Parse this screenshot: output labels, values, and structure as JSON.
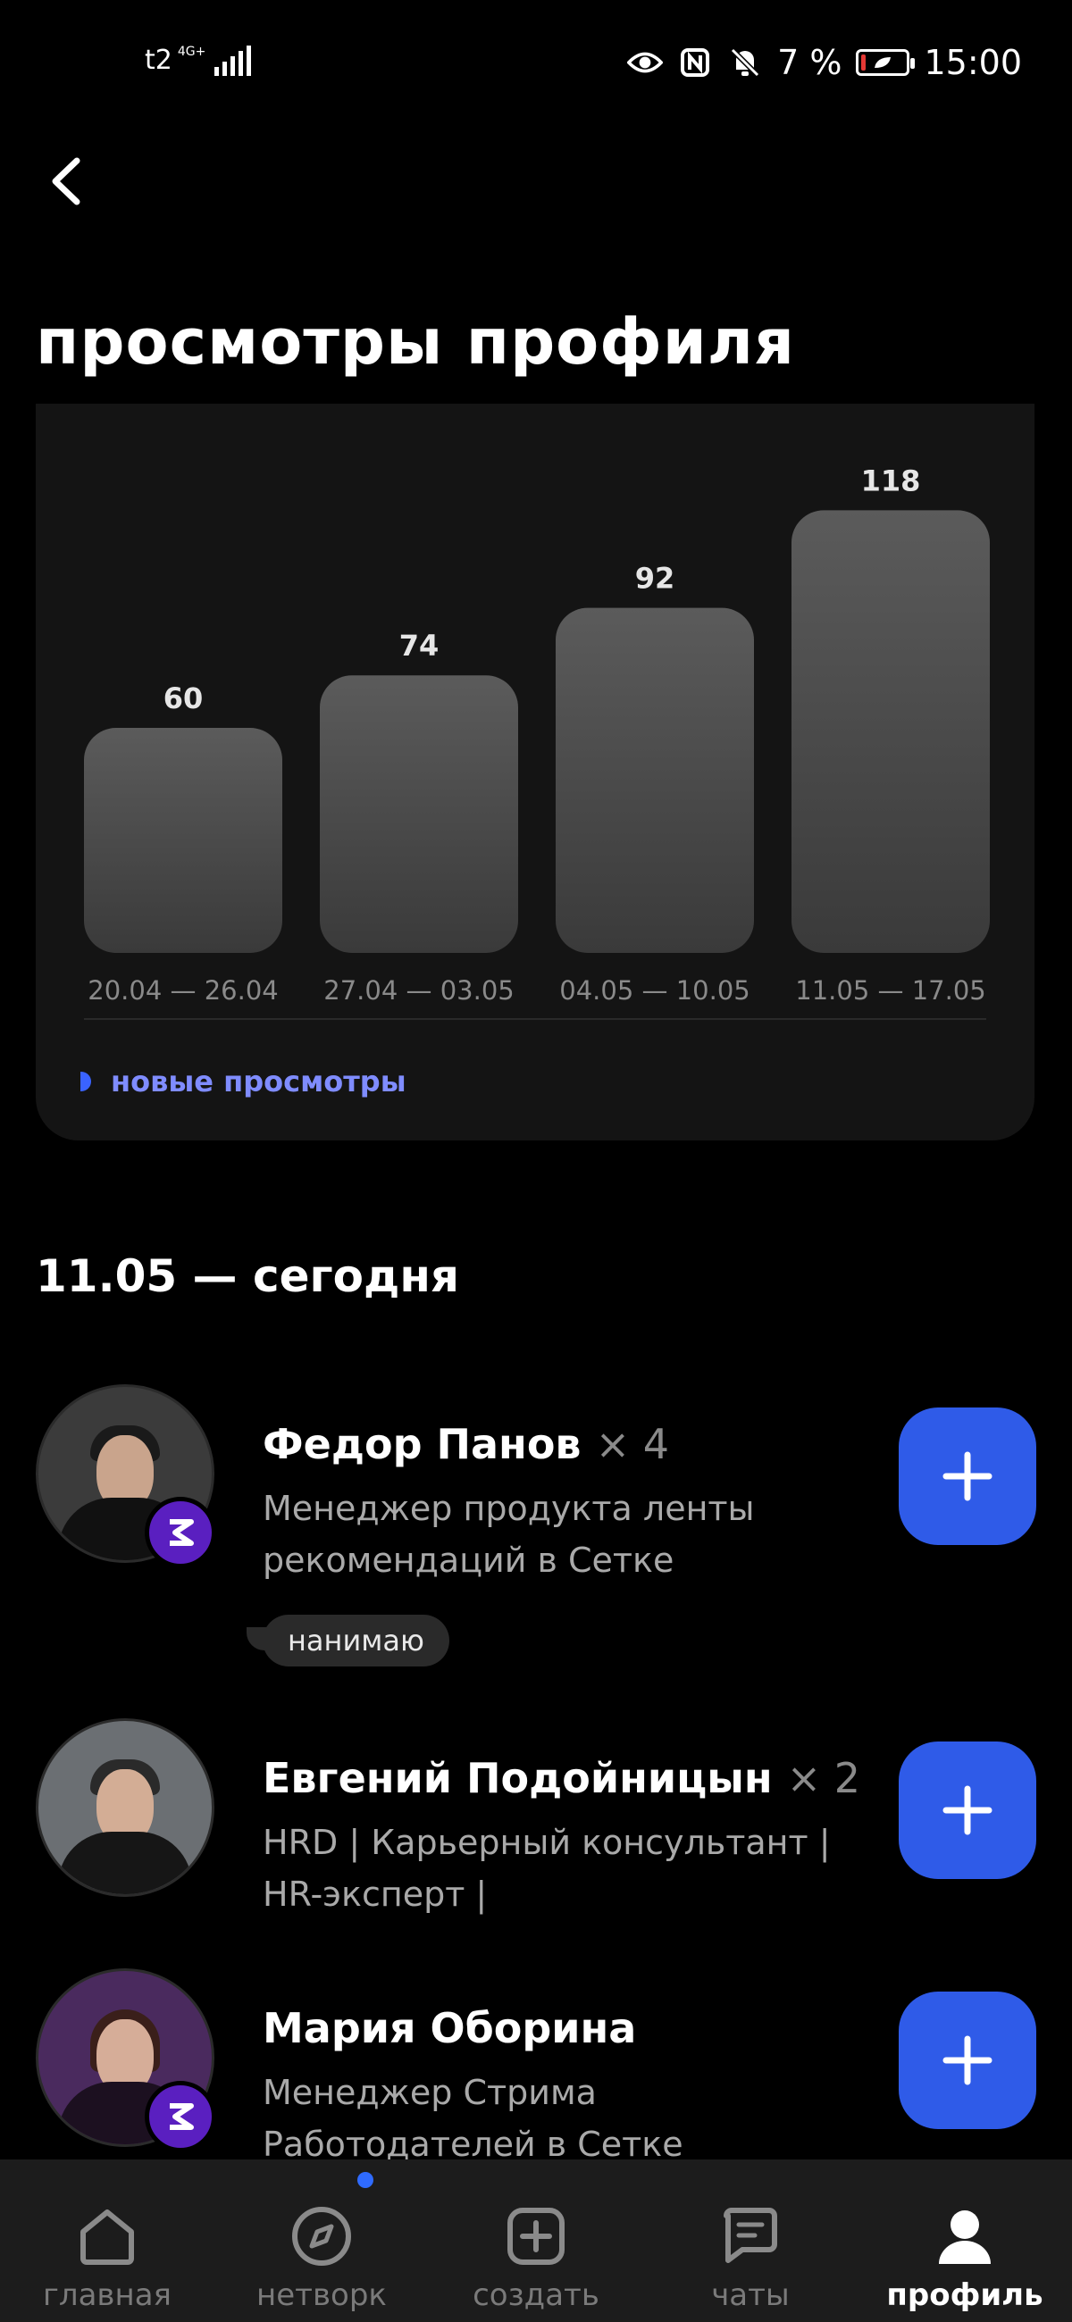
{
  "status_bar": {
    "carrier": "t2",
    "network": "4G+",
    "battery": "7 %",
    "time": "15:00",
    "icons": [
      "eye-icon",
      "nfc-icon",
      "bell-off-icon",
      "battery-icon"
    ]
  },
  "header": {
    "back_icon": "chevron-left-icon",
    "title": "просмотры профиля"
  },
  "chart_data": {
    "type": "bar",
    "categories": [
      "20.04 — 26.04",
      "27.04 — 03.05",
      "04.05 — 10.05",
      "11.05 — 17.05"
    ],
    "values": [
      60,
      74,
      92,
      118
    ],
    "series": [
      {
        "name": "новые просмотры",
        "values": [
          60,
          74,
          92,
          118
        ]
      }
    ],
    "legend_placement": "bottom-left",
    "grid": false
  },
  "legend": {
    "label": "новые просмотры",
    "color": "#3a63ff"
  },
  "section": {
    "date": "11.05 — сегодня"
  },
  "people": [
    {
      "name": "Федор Панов",
      "count": "× 4",
      "role": "Менеджер продукта ленты рекомендаций в Сетке",
      "tag": "нанимаю",
      "has_badge": true
    },
    {
      "name": "Евгений Подойницын",
      "count": "× 2",
      "role": "HRD | Карьерный консультант | HR-эксперт |",
      "tag": "",
      "has_badge": false
    },
    {
      "name": "Мария Оборина",
      "count": "",
      "role": "Менеджер Стрима Работодателей в Сетке",
      "tag": "",
      "has_badge": true
    }
  ],
  "bottom_nav": {
    "items": [
      {
        "label": "главная",
        "icon": "home-icon"
      },
      {
        "label": "нетворк",
        "icon": "compass-icon"
      },
      {
        "label": "создать",
        "icon": "plus-square-icon"
      },
      {
        "label": "чаты",
        "icon": "chat-icon"
      },
      {
        "label": "профиль",
        "icon": "profile-icon"
      }
    ],
    "active": "профиль"
  },
  "colors": {
    "accent": "#2f5be8",
    "background": "#000000",
    "card": "#141414",
    "legend_text": "#7f8cff"
  }
}
